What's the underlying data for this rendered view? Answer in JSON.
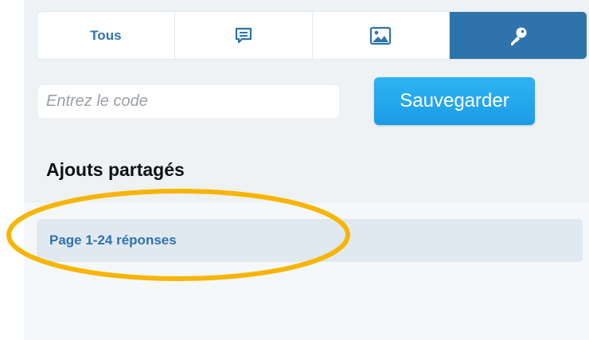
{
  "tabs": [
    {
      "label": "Tous",
      "icon": "",
      "active": false
    },
    {
      "label": "",
      "icon": "comment-icon",
      "active": false
    },
    {
      "label": "",
      "icon": "image-icon",
      "active": false
    },
    {
      "label": "",
      "icon": "key-icon",
      "active": true
    }
  ],
  "code_form": {
    "placeholder": "Entrez le code",
    "value": "",
    "save_label": "Sauvegarder"
  },
  "shared_additions": {
    "title": "Ajouts partagés",
    "items": [
      {
        "label": "Page 1-24 réponses"
      }
    ]
  },
  "colors": {
    "accent": "#2f73ad",
    "button": "#1fa5ec",
    "panel_bg": "#eef2f5",
    "list_item_bg": "#e1e9f0",
    "highlight": "#f7b500"
  }
}
